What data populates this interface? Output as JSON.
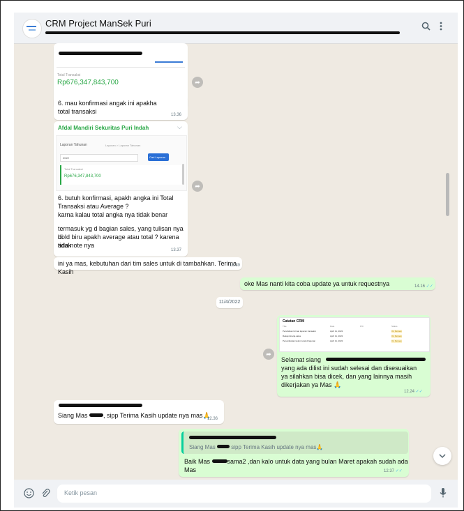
{
  "header": {
    "title": "CRM Project ManSek Puri",
    "search_icon": "search-icon",
    "menu_icon": "menu-dots-icon"
  },
  "messages": {
    "card1": {
      "label": "Total Transaksi",
      "amount": "Rp676,347,843,700"
    },
    "msg2": {
      "text": "6. mau konfirmasi angak ini apakha total transaksi",
      "time": "13.36"
    },
    "card2": {
      "company": "Afdal Mandiri Sekuritas Puri Indah",
      "tab": "Laporan Tahunan",
      "breadcrumb": "Laporan > Laporan Tahunan",
      "year": "2022",
      "button": "Cari Laporan",
      "label": "Total Transaksi",
      "amount": "Rp676,347,843,700"
    },
    "msg3": {
      "line1": "6. butuh konfirmasi, apakh angka ini Total",
      "line2": "Transaksi atau Average ?",
      "line3": "karna kalau total angka nya tidak benar",
      "line4": "termasuk yg d bagian sales, yang tulisan nya di",
      "line5": "bold biru apakh average atau total ? karena tidak",
      "line6": "ada note nya",
      "time": "13.37"
    },
    "msg4": {
      "text": "ini ya mas, kebutuhan dari tim sales untuk di tambahkan. Terima Kasih",
      "time": "13.39"
    },
    "msg5": {
      "text": "oke Mas nanti kita coba update ya untuk requestnya",
      "time": "14.16"
    },
    "date_chip": "11/4/2022",
    "msg6": {
      "doc_title": "Catatan CRM",
      "doc_cols": [
        "Title",
        "Date",
        "PIC",
        "Status"
      ],
      "doc_rows": [
        [
          "Perubahan format laporan transaksi",
          "April 11, 2022",
          "",
          "On Review"
        ],
        [
          "Rekap kinerja sales",
          "April 11, 2022",
          "",
          "On Review"
        ],
        [
          "Penambahan kolom total di laporan",
          "April 11, 2022",
          "",
          "On Review"
        ]
      ],
      "line1": "Selamat siang",
      "line2": "yang ada dilist ini sudah selesai dan disesuaikan",
      "line3": "ya silahkan bisa dicek, dan yang lainnya masih",
      "line4": "dikerjakan ya Mas",
      "emoji": "🙏",
      "time": "12.24"
    },
    "msg7": {
      "pre": "Siang Mas",
      "post": ", sipp Terima Kasih update nya mas",
      "emoji": "🙏",
      "time": "12.36"
    },
    "msg8": {
      "quote_pre": "Siang Mas",
      "quote_post": " sipp Terima Kasih update nya mas",
      "emoji": "🙏",
      "pre": "Baik Mas",
      "post": "sama2 ,dan kalo untuk data yang bulan Maret apakah sudah ada Mas",
      "time": "12.37"
    }
  },
  "footer": {
    "placeholder": "Ketik pesan",
    "emoji_icon": "emoji-icon",
    "attach_icon": "paperclip-icon",
    "mic_icon": "microphone-icon"
  },
  "colors": {
    "incoming": "#ffffff",
    "outgoing": "#d9fdd3",
    "accent_green": "#28a745",
    "tick_blue": "#53bdeb",
    "background": "#efeae2"
  }
}
